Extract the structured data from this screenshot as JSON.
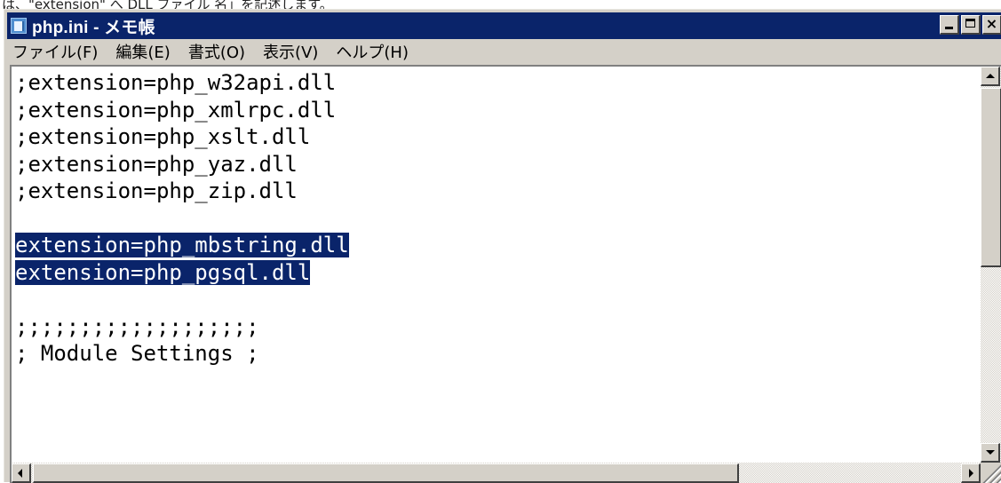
{
  "page_caption": "は、\"extension\" へ DLL ファイル 名」を記述します。",
  "window": {
    "title": "php.ini - メモ帳",
    "icon": "notepad-icon",
    "caption_buttons": {
      "minimize": "_",
      "maximize": "□",
      "close": "×"
    }
  },
  "menu": [
    {
      "label": "ファイル(F)"
    },
    {
      "label": "編集(E)"
    },
    {
      "label": "書式(O)"
    },
    {
      "label": "表示(V)"
    },
    {
      "label": "ヘルプ(H)"
    }
  ],
  "editor": {
    "lines": [
      {
        "text": ";extension=php_w32api.dll",
        "selected": false
      },
      {
        "text": ";extension=php_xmlrpc.dll",
        "selected": false
      },
      {
        "text": ";extension=php_xslt.dll",
        "selected": false
      },
      {
        "text": ";extension=php_yaz.dll",
        "selected": false
      },
      {
        "text": ";extension=php_zip.dll",
        "selected": false
      },
      {
        "text": "",
        "selected": false
      },
      {
        "text": "extension=php_mbstring.dll",
        "selected": true
      },
      {
        "text": "extension=php_pgsql.dll",
        "selected": true
      },
      {
        "text": "",
        "selected": false
      },
      {
        "text": ";;;;;;;;;;;;;;;;;;;",
        "selected": false
      },
      {
        "text": "; Module Settings ;",
        "selected": false
      }
    ],
    "selection_color": "#0a246a"
  },
  "colors": {
    "titlebar": "#0a246a",
    "face": "#d4d0c8"
  }
}
